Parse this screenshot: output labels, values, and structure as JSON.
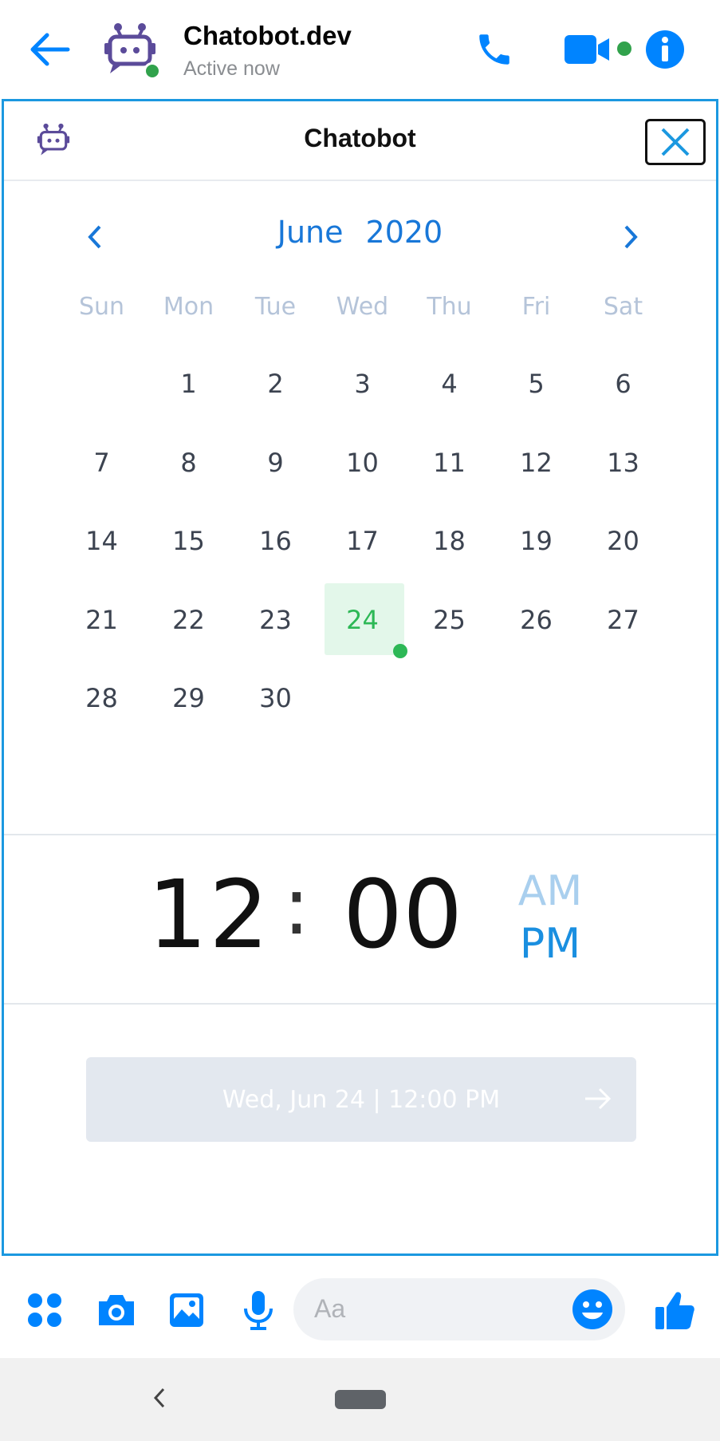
{
  "header": {
    "contact_name": "Chatobot.dev",
    "contact_status": "Active now",
    "accent_color": "#0084ff",
    "online_color": "#31a24c",
    "icons": [
      "back-arrow-icon",
      "bot-avatar-icon",
      "phone-icon",
      "video-camera-icon",
      "info-icon"
    ]
  },
  "webview": {
    "title": "Chatobot",
    "border_color": "#1b98e0",
    "icons": [
      "bot-logo-icon",
      "close-icon"
    ]
  },
  "calendar": {
    "month": "June",
    "year": "2020",
    "weekdays": [
      "Sun",
      "Mon",
      "Tue",
      "Wed",
      "Thu",
      "Fri",
      "Sat"
    ],
    "leading_blank_days": 1,
    "days": [
      "1",
      "2",
      "3",
      "4",
      "5",
      "6",
      "7",
      "8",
      "9",
      "10",
      "11",
      "12",
      "13",
      "14",
      "15",
      "16",
      "17",
      "18",
      "19",
      "20",
      "21",
      "22",
      "23",
      "24",
      "25",
      "26",
      "27",
      "28",
      "29",
      "30"
    ],
    "selected_day": "24",
    "selected_color": "#2db856"
  },
  "time": {
    "hours": "12",
    "separator": ":",
    "minutes": "00",
    "am_label": "AM",
    "pm_label": "PM",
    "selected_period": "PM"
  },
  "confirm": {
    "label": "Wed, Jun 24 | 12:00 PM",
    "enabled": false
  },
  "composer": {
    "placeholder": "Aa",
    "icons": [
      "apps-icon",
      "camera-icon",
      "gallery-icon",
      "microphone-icon",
      "emoji-icon",
      "thumbs-up-icon"
    ]
  }
}
